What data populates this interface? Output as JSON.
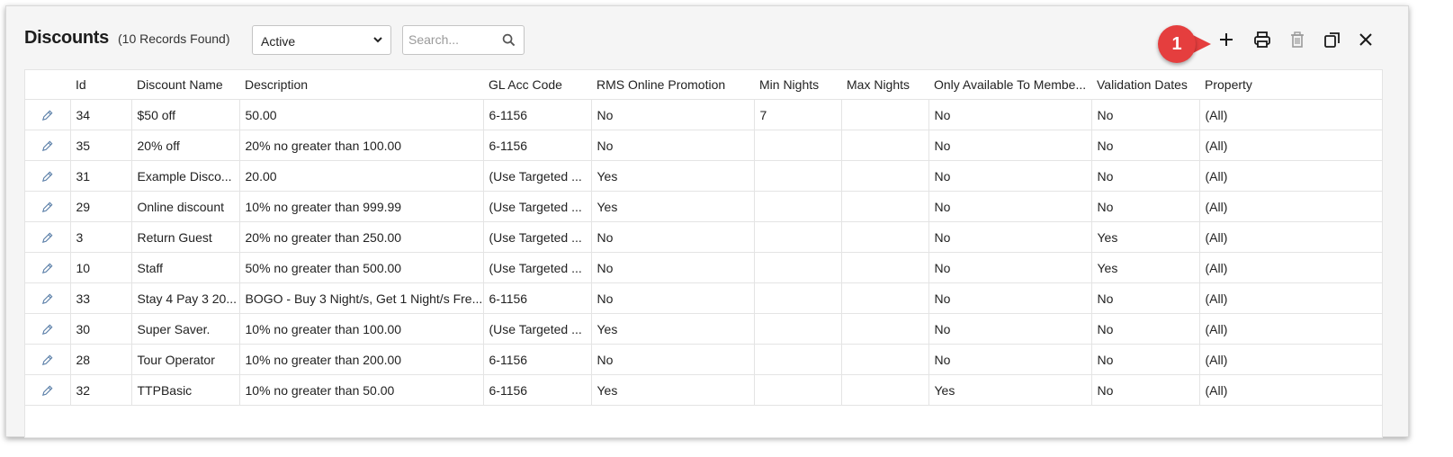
{
  "header": {
    "title": "Discounts",
    "record_count": "(10 Records Found)",
    "filter_value": "Active",
    "search_placeholder": "Search..."
  },
  "callout": {
    "number": "1",
    "color": "#e53e3e"
  },
  "toolbar": {
    "icons": [
      "plus-icon",
      "print-icon",
      "trash-icon",
      "copy-icon",
      "close-icon"
    ]
  },
  "table": {
    "columns": [
      "",
      "Id",
      "Discount Name",
      "Description",
      "GL Acc Code",
      "RMS Online Promotion",
      "Min Nights",
      "Max Nights",
      "Only Available To Membe...",
      "Validation Dates",
      "Property"
    ],
    "rows": [
      [
        "34",
        "$50 off",
        "50.00",
        "6-1156",
        "No",
        "7",
        "",
        "No",
        "No",
        "(All)"
      ],
      [
        "35",
        "20% off",
        "20% no greater than 100.00",
        "6-1156",
        "No",
        "",
        "",
        "No",
        "No",
        "(All)"
      ],
      [
        "31",
        "Example Disco...",
        "20.00",
        "(Use Targeted ...",
        "Yes",
        "",
        "",
        "No",
        "No",
        "(All)"
      ],
      [
        "29",
        "Online discount",
        "10% no greater than 999.99",
        "(Use Targeted ...",
        "Yes",
        "",
        "",
        "No",
        "No",
        "(All)"
      ],
      [
        "3",
        "Return Guest",
        "20% no greater than 250.00",
        "(Use Targeted ...",
        "No",
        "",
        "",
        "No",
        "Yes",
        "(All)"
      ],
      [
        "10",
        "Staff",
        "50% no greater than 500.00",
        "(Use Targeted ...",
        "No",
        "",
        "",
        "No",
        "Yes",
        "(All)"
      ],
      [
        "33",
        "Stay 4 Pay 3 20...",
        "BOGO - Buy 3 Night/s, Get 1 Night/s Fre...",
        "6-1156",
        "No",
        "",
        "",
        "No",
        "No",
        "(All)"
      ],
      [
        "30",
        "Super Saver.",
        "10% no greater than 100.00",
        "(Use Targeted ...",
        "Yes",
        "",
        "",
        "No",
        "No",
        "(All)"
      ],
      [
        "28",
        "Tour Operator",
        "10% no greater than 200.00",
        "6-1156",
        "No",
        "",
        "",
        "No",
        "No",
        "(All)"
      ],
      [
        "32",
        "TTPBasic",
        "10% no greater than 50.00",
        "6-1156",
        "Yes",
        "",
        "",
        "Yes",
        "No",
        "(All)"
      ]
    ]
  }
}
